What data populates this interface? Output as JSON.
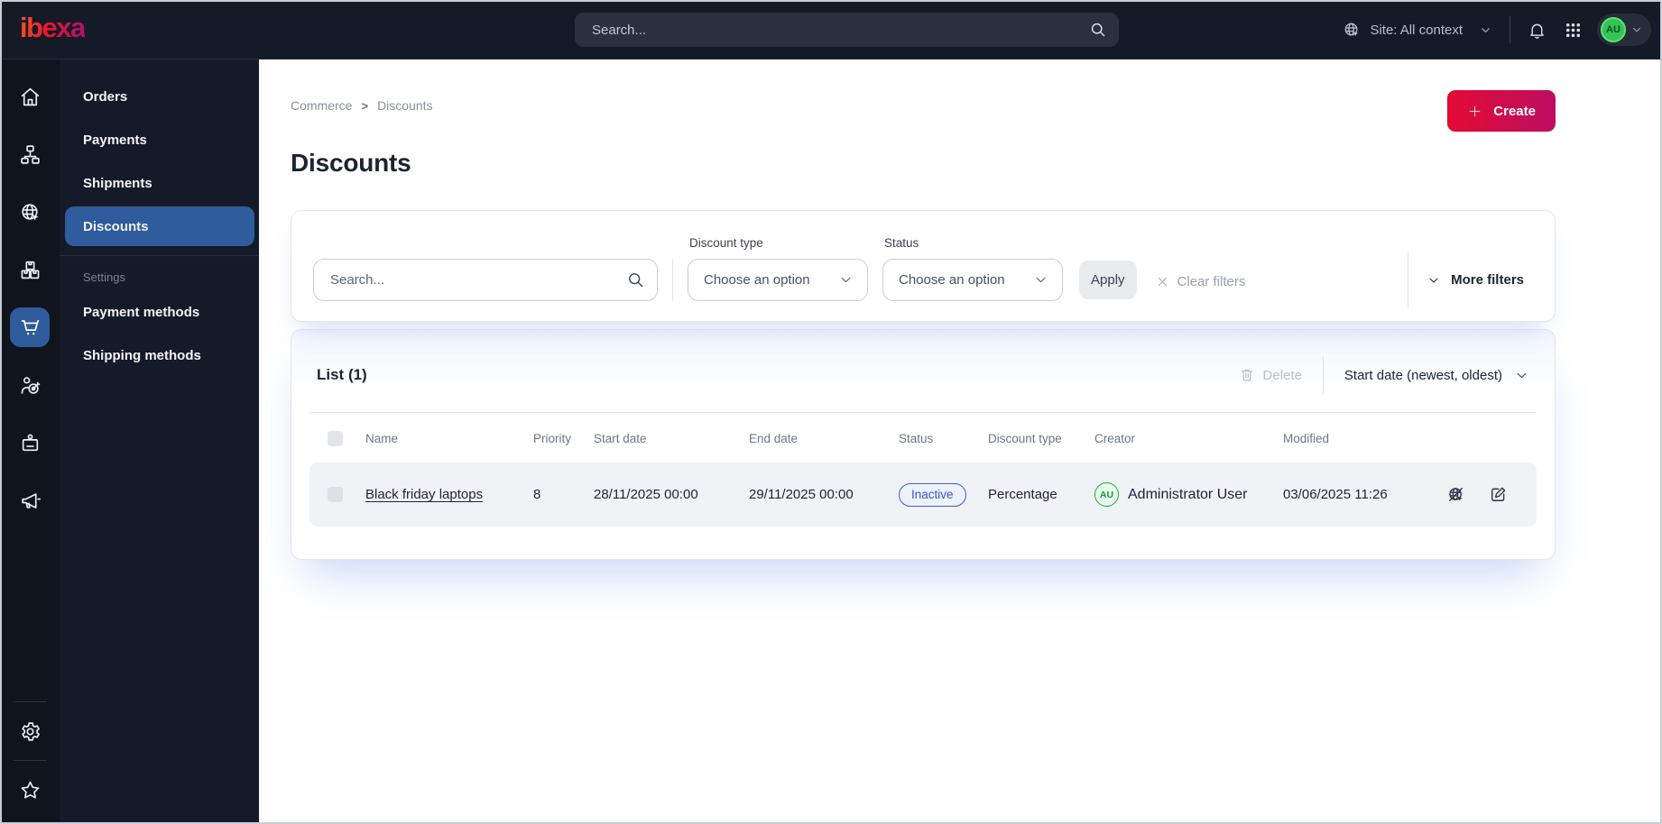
{
  "topbar": {
    "logo_text": "ibexa",
    "search_placeholder": "Search...",
    "site_context_label": "Site: All context",
    "user_initials": "AU"
  },
  "sidebar": {
    "rail_icons": [
      "home",
      "content-tree",
      "site-context",
      "product-catalog",
      "commerce",
      "customer-portal",
      "members",
      "campaigns",
      "settings",
      "bookmarks"
    ],
    "menu": [
      {
        "label": "Orders",
        "active": false
      },
      {
        "label": "Payments",
        "active": false
      },
      {
        "label": "Shipments",
        "active": false
      },
      {
        "label": "Discounts",
        "active": true
      }
    ],
    "settings_heading": "Settings",
    "settings_menu": [
      {
        "label": "Payment methods"
      },
      {
        "label": "Shipping methods"
      }
    ]
  },
  "breadcrumb": {
    "items": [
      "Commerce",
      "Discounts"
    ],
    "separator": ">"
  },
  "page": {
    "title": "Discounts"
  },
  "actions": {
    "create_label": "Create"
  },
  "filters": {
    "search_placeholder": "Search...",
    "fields": [
      {
        "label": "Discount type",
        "value": "Choose an option"
      },
      {
        "label": "Status",
        "value": "Choose an option"
      }
    ],
    "apply_label": "Apply",
    "clear_label": "Clear filters",
    "more_filters_label": "More filters"
  },
  "list": {
    "title": "List (1)",
    "delete_label": "Delete",
    "sort_label": "Start date (newest, oldest)",
    "columns": [
      "Name",
      "Priority",
      "Start date",
      "End date",
      "Status",
      "Discount type",
      "Creator",
      "Modified"
    ],
    "rows": [
      {
        "name": "Black friday laptops",
        "priority": 8,
        "start_date": "28/11/2025 00:00",
        "end_date": "29/11/2025 00:00",
        "status": "Inactive",
        "discount_type": "Percentage",
        "creator_initials": "AU",
        "creator_name": "Administrator User",
        "modified": "03/06/2025 11:26"
      }
    ]
  },
  "colors": {
    "topbar_bg": "#151b26",
    "rail_bg": "#0f141d",
    "submenu_bg": "#141a27",
    "accent_blue": "#2e5c9c",
    "create_gradient_start": "#e30b33",
    "create_gradient_end": "#bc0e62",
    "status_inactive_blue": "#3455cb",
    "creator_green": "#17ab35"
  }
}
